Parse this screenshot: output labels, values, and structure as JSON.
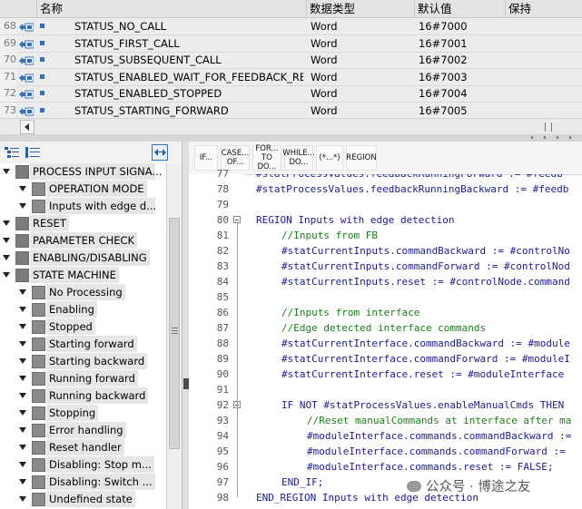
{
  "table": {
    "headers": {
      "name": "名称",
      "datatype": "数据类型",
      "default": "默认值",
      "retain": "保持"
    },
    "rows": [
      {
        "num": "68",
        "name": "STATUS_NO_CALL",
        "type": "Word",
        "value": "16#7000"
      },
      {
        "num": "69",
        "name": "STATUS_FIRST_CALL",
        "type": "Word",
        "value": "16#7001"
      },
      {
        "num": "70",
        "name": "STATUS_SUBSEQUENT_CALL",
        "type": "Word",
        "value": "16#7002"
      },
      {
        "num": "71",
        "name": "STATUS_ENABLED_WAIT_FOR_FEEDBACK_REA...",
        "type": "Word",
        "value": "16#7003"
      },
      {
        "num": "72",
        "name": "STATUS_ENABLED_STOPPED",
        "type": "Word",
        "value": "16#7004"
      },
      {
        "num": "73",
        "name": "STATUS_STARTING_FORWARD",
        "type": "Word",
        "value": "16#7005"
      }
    ]
  },
  "toolbar": {
    "buttons": [
      "IF...",
      "CASE... OF...",
      "FOR... TO DO...",
      "WHILE... DO...",
      "(*...*)",
      "REGION"
    ]
  },
  "tree": [
    {
      "label": "PROCESS INPUT SIGNA...",
      "level": 0
    },
    {
      "label": "OPERATION MODE",
      "level": 1
    },
    {
      "label": "Inputs with edge d...",
      "level": 1
    },
    {
      "label": "RESET",
      "level": 0
    },
    {
      "label": "PARAMETER CHECK",
      "level": 0
    },
    {
      "label": "ENABLING/DISABLING",
      "level": 0
    },
    {
      "label": "STATE MACHINE",
      "level": 0
    },
    {
      "label": "No Processing",
      "level": 1
    },
    {
      "label": "Enabling",
      "level": 1
    },
    {
      "label": "Stopped",
      "level": 1
    },
    {
      "label": "Starting forward",
      "level": 1
    },
    {
      "label": "Starting backward",
      "level": 1
    },
    {
      "label": "Running forward",
      "level": 1
    },
    {
      "label": "Running backward",
      "level": 1
    },
    {
      "label": "Stopping",
      "level": 1
    },
    {
      "label": "Error handling",
      "level": 1
    },
    {
      "label": "Reset handler",
      "level": 1
    },
    {
      "label": "Disabling: Stop m...",
      "level": 1
    },
    {
      "label": "Disabling: Switch ...",
      "level": 1
    },
    {
      "label": "Undefined state",
      "level": 1
    }
  ],
  "code": {
    "lines": [
      {
        "num": "77",
        "text": "#statProcessValues.feedbackRunningForward := #feedb",
        "kind": "code",
        "indent": 0
      },
      {
        "num": "78",
        "text": "#statProcessValues.feedbackRunningBackward := #feedb",
        "kind": "code",
        "indent": 0
      },
      {
        "num": "79",
        "text": "",
        "kind": "code",
        "indent": 0
      },
      {
        "num": "80",
        "text": "REGION Inputs with edge detection",
        "kind": "kw",
        "indent": 0
      },
      {
        "num": "81",
        "text": "//Inputs from FB",
        "kind": "cm",
        "indent": 1
      },
      {
        "num": "82",
        "text": "#statCurrentInputs.commandBackward := #controlNo",
        "kind": "code",
        "indent": 1
      },
      {
        "num": "83",
        "text": "#statCurrentInputs.commandForward := #controlNod",
        "kind": "code",
        "indent": 1
      },
      {
        "num": "84",
        "text": "#statCurrentInputs.reset := #controlNode.command",
        "kind": "code",
        "indent": 1
      },
      {
        "num": "85",
        "text": "",
        "kind": "code",
        "indent": 0
      },
      {
        "num": "86",
        "text": "//Inputs from interface",
        "kind": "cm",
        "indent": 1
      },
      {
        "num": "87",
        "text": "//Edge detected interface commands",
        "kind": "cm",
        "indent": 1
      },
      {
        "num": "88",
        "text": "#statCurrentInterface.commandBackward := #module",
        "kind": "code",
        "indent": 1
      },
      {
        "num": "89",
        "text": "#statCurrentInterface.commandForward := #moduleI",
        "kind": "code",
        "indent": 1
      },
      {
        "num": "90",
        "text": "#statCurrentInterface.reset := #moduleInterface",
        "kind": "code",
        "indent": 1
      },
      {
        "num": "91",
        "text": "",
        "kind": "code",
        "indent": 0
      },
      {
        "num": "92",
        "text": "IF NOT #statProcessValues.enableManualCmds THEN",
        "kind": "kw",
        "indent": 1
      },
      {
        "num": "93",
        "text": "//Reset manualCommands at interface after ma",
        "kind": "cm",
        "indent": 2
      },
      {
        "num": "94",
        "text": "#moduleInterface.commands.commandBackward :=",
        "kind": "code",
        "indent": 2
      },
      {
        "num": "95",
        "text": "#moduleInterface.commands.commandForward :=",
        "kind": "code",
        "indent": 2
      },
      {
        "num": "96",
        "text": "#moduleInterface.commands.reset := FALSE;",
        "kind": "code",
        "indent": 2
      },
      {
        "num": "97",
        "text": "END_IF;",
        "kind": "kw",
        "indent": 1
      },
      {
        "num": "98",
        "text": "END_REGION Inputs with edge detection",
        "kind": "kw",
        "indent": 0
      }
    ]
  },
  "watermark": "公众号 · 博途之友"
}
